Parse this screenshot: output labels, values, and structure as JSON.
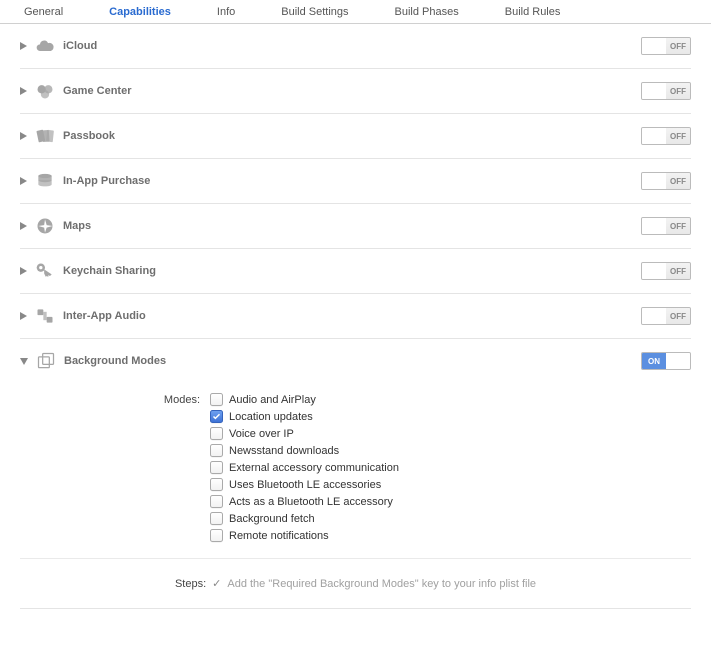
{
  "tabs": {
    "items": [
      {
        "label": "General",
        "active": false
      },
      {
        "label": "Capabilities",
        "active": true
      },
      {
        "label": "Info",
        "active": false
      },
      {
        "label": "Build Settings",
        "active": false
      },
      {
        "label": "Build Phases",
        "active": false
      },
      {
        "label": "Build Rules",
        "active": false
      }
    ]
  },
  "toggle_labels": {
    "on": "ON",
    "off": "OFF"
  },
  "sections": [
    {
      "title": "iCloud",
      "icon": "cloud-icon",
      "enabled": false,
      "expanded": false
    },
    {
      "title": "Game Center",
      "icon": "gamecenter-icon",
      "enabled": false,
      "expanded": false
    },
    {
      "title": "Passbook",
      "icon": "passbook-icon",
      "enabled": false,
      "expanded": false
    },
    {
      "title": "In-App Purchase",
      "icon": "iap-icon",
      "enabled": false,
      "expanded": false
    },
    {
      "title": "Maps",
      "icon": "maps-icon",
      "enabled": false,
      "expanded": false
    },
    {
      "title": "Keychain Sharing",
      "icon": "keychain-icon",
      "enabled": false,
      "expanded": false
    },
    {
      "title": "Inter-App Audio",
      "icon": "interapp-audio-icon",
      "enabled": false,
      "expanded": false
    },
    {
      "title": "Background Modes",
      "icon": "background-modes-icon",
      "enabled": true,
      "expanded": true
    }
  ],
  "background_modes": {
    "section_label": "Modes:",
    "modes": [
      {
        "label": "Audio and AirPlay",
        "checked": false
      },
      {
        "label": "Location updates",
        "checked": true
      },
      {
        "label": "Voice over IP",
        "checked": false
      },
      {
        "label": "Newsstand downloads",
        "checked": false
      },
      {
        "label": "External accessory communication",
        "checked": false
      },
      {
        "label": "Uses Bluetooth LE accessories",
        "checked": false
      },
      {
        "label": "Acts as a Bluetooth LE accessory",
        "checked": false
      },
      {
        "label": "Background fetch",
        "checked": false
      },
      {
        "label": "Remote notifications",
        "checked": false
      }
    ],
    "steps_label": "Steps:",
    "steps_text": "Add the \"Required Background Modes\" key to your info plist file"
  }
}
